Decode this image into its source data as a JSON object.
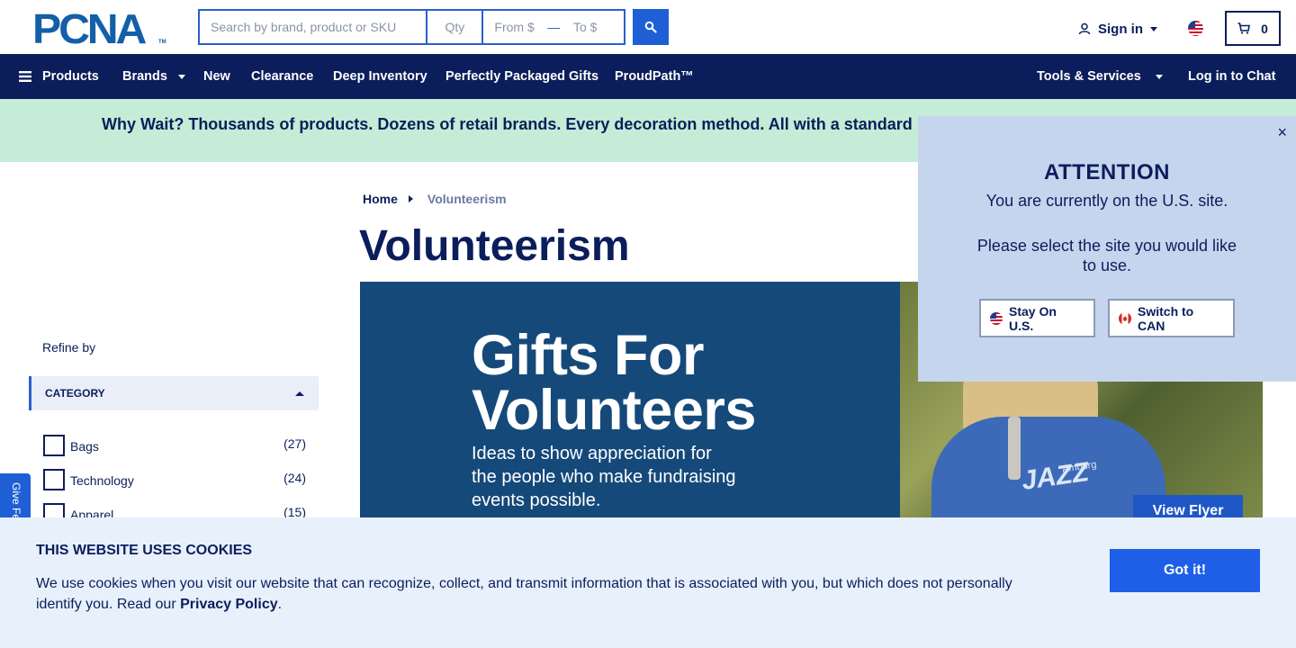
{
  "header": {
    "logo_text": "PCNA",
    "search_placeholder": "Search by brand, product or SKU",
    "qty_placeholder": "Qty",
    "price_from_placeholder": "From $",
    "price_to_placeholder": "To $",
    "signin_label": "Sign in",
    "cart_count": "0"
  },
  "nav": {
    "products": "Products",
    "brands": "Brands",
    "new": "New",
    "clearance": "Clearance",
    "deep_inventory": "Deep Inventory",
    "gifts": "Perfectly Packaged Gifts",
    "proudpath": "ProudPath™",
    "tools": "Tools & Services",
    "chat": "Log in to Chat"
  },
  "promo": {
    "text": "Why Wait? Thousands of products. Dozens of retail brands. Every decoration method. All with a standard"
  },
  "breadcrumb": {
    "home": "Home",
    "current": "Volunteerism"
  },
  "page": {
    "title": "Volunteerism"
  },
  "hero": {
    "title_line1": "Gifts For",
    "title_line2": "Volunteers",
    "subtitle": "Ideas to show appreciation for the people who make fundraising events possible.",
    "hoodie_text": "JAZZ",
    "hoodie_small": "Amburg",
    "cta": "View Flyer"
  },
  "sidebar": {
    "refine_label": "Refine by",
    "category_header": "CATEGORY",
    "categories": [
      {
        "label": "Bags",
        "count": "(27)"
      },
      {
        "label": "Technology",
        "count": "(24)"
      },
      {
        "label": "Apparel",
        "count": "(15)"
      }
    ]
  },
  "feedback": {
    "label": "Give Feedback"
  },
  "region_popup": {
    "title": "ATTENTION",
    "line1": "You are currently on the U.S. site.",
    "line2": "Please select the site you would like to use.",
    "stay_label": "Stay On U.S.",
    "switch_label": "Switch to CAN",
    "close": "×"
  },
  "cookie_banner": {
    "title": "THIS WEBSITE USES COOKIES",
    "text": "We use cookies when you visit our website that can recognize, collect, and transmit information that is associated with you, but which does not personally identify you. Read our ",
    "link": "Privacy Policy",
    "period": ".",
    "button": "Got it!"
  },
  "colors": {
    "navy": "#0b1e5b",
    "accent_blue": "#1f5fd6",
    "promo_green": "#c5ecd6",
    "popup_bg": "#c6d5ee",
    "cookie_bg": "#e8f0fb",
    "hero_blue": "#15497a"
  }
}
